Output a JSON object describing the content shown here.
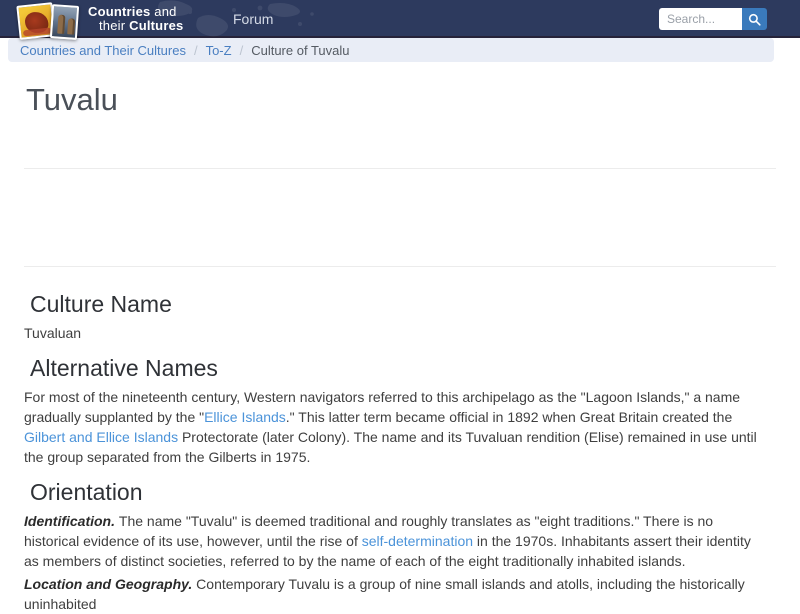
{
  "navbar": {
    "brand": {
      "line1_bold": "Countries",
      "line1_rest": " and",
      "line2_rest": "their ",
      "line2_bold": "Cultures"
    },
    "forum_label": "Forum",
    "search_placeholder": "Search..."
  },
  "breadcrumb": {
    "separator": "/",
    "items": [
      {
        "label": "Countries and Their Cultures"
      },
      {
        "label": "To-Z"
      },
      {
        "label": "Culture of Tuvalu"
      }
    ]
  },
  "page": {
    "title": "Tuvalu",
    "sections": [
      {
        "heading": "Culture Name",
        "paragraphs": [
          {
            "segments": [
              {
                "t": "Tuvaluan"
              }
            ]
          }
        ]
      },
      {
        "heading": "Alternative Names",
        "paragraphs": [
          {
            "segments": [
              {
                "t": "For most of the nineteenth century, Western navigators referred to this archipelago as the \"Lagoon Islands,\" a name gradually supplanted by the \""
              },
              {
                "t": "Ellice Islands",
                "link": true
              },
              {
                "t": ".\" This latter term became official in 1892 when Great Britain created the "
              },
              {
                "t": "Gilbert and Ellice Islands",
                "link": true
              },
              {
                "t": " Protectorate (later Colony). The name and its Tuvaluan rendition (Elise) remained in use until the group separated from the Gilberts in 1975."
              }
            ]
          }
        ]
      },
      {
        "heading": "Orientation",
        "paragraphs": [
          {
            "segments": [
              {
                "t": "Identification. ",
                "lead": true
              },
              {
                "t": "The name \"Tuvalu\" is deemed traditional and roughly translates as \"eight traditions.\" There is no historical evidence of its use, however, until the rise of "
              },
              {
                "t": "self-determination",
                "link": true
              },
              {
                "t": " in the 1970s. Inhabitants assert their identity as members of distinct societies, referred to by the name of each of the eight traditionally inhabited islands."
              }
            ]
          },
          {
            "segments": [
              {
                "t": "Location and Geography. ",
                "lead": true
              },
              {
                "t": "Contemporary Tuvalu is a group of nine small islands and atolls, including the historically uninhabited"
              }
            ]
          }
        ]
      }
    ]
  },
  "colors": {
    "navbar_bg": "#2d3a5e",
    "navbar_border": "#262339",
    "breadcrumb_bg": "#e9edf6",
    "breadcrumb_link": "#4a7fc1",
    "body_link": "#4b93d9",
    "search_button": "#3a7abc",
    "divider": "#ececec",
    "title_text": "#4a5058",
    "body_text": "#3f3f3f"
  }
}
